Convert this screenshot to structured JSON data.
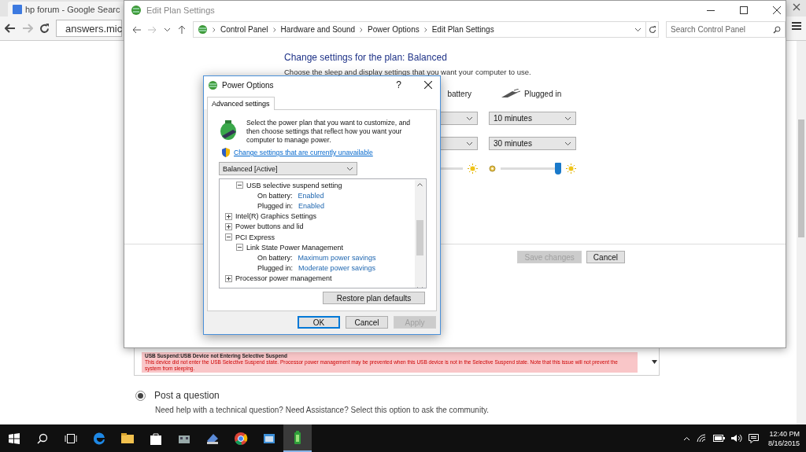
{
  "browser": {
    "tab": {
      "title": "hp forum - Google Searc"
    },
    "address": "answers.mic",
    "error_box": {
      "title": "USB Suspend:USB Device not Entering Selective Suspend",
      "text": "This device did not enter the USB Selective Suspend state. Processor power management may be prevented when this USB device is not in the Selective Suspend state. Note that this issue will not prevent the system from sleeping."
    },
    "options": [
      {
        "label": "Post a question",
        "description": "Need help with a technical question? Need Assistance? Select this option to ask the community.",
        "selected": true
      }
    ]
  },
  "control_panel": {
    "title": "Edit Plan Settings",
    "breadcrumbs": [
      "Control Panel",
      "Hardware and Sound",
      "Power Options",
      "Edit Plan Settings"
    ],
    "search": {
      "placeholder": "Search Control Panel"
    },
    "heading": "Change settings for the plan: Balanced",
    "subheading": "Choose the sleep and display settings that you want your computer to use.",
    "columns": [
      "battery",
      "Plugged in"
    ],
    "settings": [
      {
        "kind": "dropdown",
        "plugged_in": "10 minutes"
      },
      {
        "kind": "dropdown",
        "plugged_in": "30 minutes"
      },
      {
        "kind": "slider",
        "level": 0.95
      }
    ],
    "buttons": [
      {
        "label": "Save changes",
        "disabled": true
      },
      {
        "label": "Cancel",
        "disabled": false
      }
    ]
  },
  "dialog": {
    "title": "Power Options",
    "help": "?",
    "tabs": [
      {
        "label": "Advanced settings",
        "selected": true
      }
    ],
    "intro": "Select the power plan that you want to customize, and then choose settings that reflect how you want your computer to manage power.",
    "link": "Change settings that are currently unavailable",
    "plan": "Balanced [Active]",
    "tree": [
      {
        "children": [
          {
            "label": "USB selective suspend setting",
            "expanded": true,
            "children": [
              {
                "kind": "setting",
                "label": "On battery:",
                "value": "Enabled"
              },
              {
                "kind": "setting",
                "label": "Plugged in:",
                "value": "Enabled"
              }
            ]
          }
        ]
      },
      {
        "label": "Intel(R) Graphics Settings",
        "expanded": false
      },
      {
        "label": "Power buttons and lid",
        "expanded": false
      },
      {
        "label": "PCI Express",
        "expanded": true,
        "children": [
          {
            "label": "Link State Power Management",
            "expanded": true,
            "children": [
              {
                "kind": "setting",
                "label": "On battery:",
                "value": "Maximum power savings"
              },
              {
                "kind": "setting",
                "label": "Plugged in:",
                "value": "Moderate power savings"
              }
            ]
          }
        ]
      },
      {
        "label": "Processor power management",
        "expanded": false
      }
    ],
    "restore_button": "Restore plan defaults",
    "buttons": [
      {
        "label": "OK",
        "default": true,
        "disabled": false
      },
      {
        "label": "Cancel",
        "default": false,
        "disabled": false
      },
      {
        "label": "Apply",
        "default": false,
        "disabled": true
      }
    ]
  },
  "taskbar": {
    "apps": [
      {
        "selected": false
      },
      {
        "selected": false
      },
      {
        "selected": false
      },
      {
        "selected": false
      },
      {
        "selected": false
      },
      {
        "selected": false
      },
      {
        "selected": false
      },
      {
        "selected": true
      }
    ],
    "time": "12:40 PM",
    "date": "8/16/2015"
  }
}
